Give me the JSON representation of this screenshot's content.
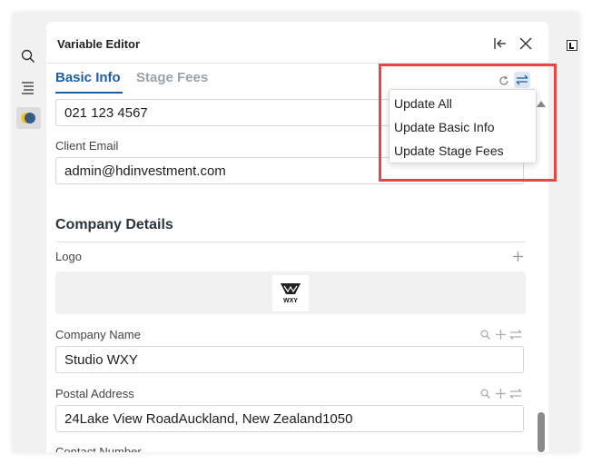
{
  "panel": {
    "title": "Variable Editor"
  },
  "tabs": [
    {
      "label": "Basic Info",
      "active": true
    },
    {
      "label": "Stage Fees",
      "active": false
    }
  ],
  "fields": {
    "phone": {
      "value": "021 123 4567"
    },
    "client_email": {
      "label": "Client Email",
      "value": "admin@hdinvestment.com"
    }
  },
  "company": {
    "heading": "Company Details",
    "logo": {
      "label": "Logo",
      "image_text": "WXY"
    },
    "company_name": {
      "label": "Company Name",
      "value": "Studio WXY"
    },
    "postal_address": {
      "label": "Postal Address",
      "value": "24Lake View RoadAuckland, New Zealand1050"
    },
    "contact_number": {
      "label": "Contact Number"
    }
  },
  "dropdown": {
    "items": [
      "Update All",
      "Update Basic Info",
      "Update Stage Fees"
    ]
  },
  "colors": {
    "accent": "#1e5fa3",
    "highlight": "#e84545"
  }
}
